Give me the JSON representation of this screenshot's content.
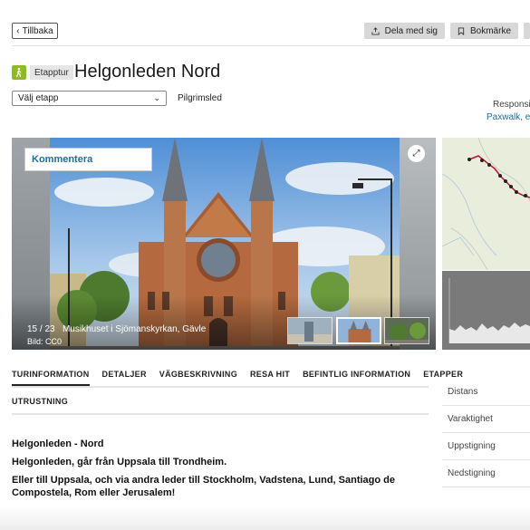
{
  "header": {
    "back_label": "Tillbaka",
    "actions": [
      {
        "label": "Dela med sig",
        "icon": "share-icon"
      },
      {
        "label": "Bokmärke",
        "icon": "bookmark-icon"
      }
    ]
  },
  "route": {
    "type_label": "Etapptur",
    "title": "Helgonleden Nord",
    "stage_select_value": "Välj etapp",
    "category": "Pilgrimsled",
    "responsible_label": "Responsib",
    "responsible_link": "Paxwalk, ek"
  },
  "gallery": {
    "comment_label": "Kommentera",
    "counter": "15 / 23",
    "caption": "Musikhuset i Sjömanskyrkan, Gävle",
    "credit": "Bild: CC0"
  },
  "tabs": {
    "row1": [
      "TURINFORMATION",
      "DETALJER",
      "VÄGBESKRIVNING",
      "RESA HIT",
      "BEFINTLIG INFORMATION",
      "ETAPPER"
    ],
    "row2": [
      "UTRUSTNING"
    ]
  },
  "facts": [
    "Distans",
    "Varaktighet",
    "Uppstigning",
    "Nedstigning"
  ],
  "description": [
    "Helgonleden - Nord",
    "Helgonleden, går från Uppsala till Trondheim.",
    "Eller till Uppsala, och via andra leder till Stockholm, Vadstena, Lund, Santiago de Compostela, Rom eller Jerusalem!"
  ],
  "colors": {
    "accent_green": "#8cbb1f",
    "link_blue": "#1f6e9a",
    "route_red": "#c8102e"
  }
}
